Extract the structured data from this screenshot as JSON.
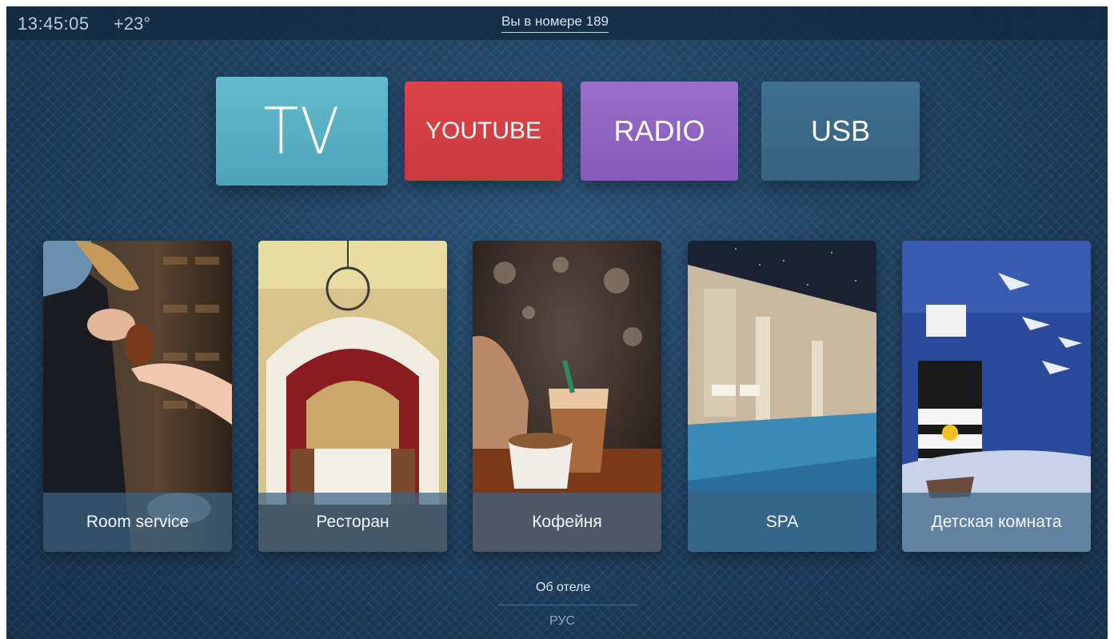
{
  "status_bar": {
    "time": "13:45:05",
    "temperature": "+23°",
    "room_label": "Вы в номере 189"
  },
  "apps": [
    {
      "label": "TV",
      "color": "#55afc4"
    },
    {
      "label": "YOUTUBE",
      "color": "#d64043"
    },
    {
      "label": "RADIO",
      "color": "#9065c2"
    },
    {
      "label": "USB",
      "color": "#3a6987"
    }
  ],
  "services": [
    {
      "label": "Room service"
    },
    {
      "label": "Ресторан"
    },
    {
      "label": "Кофейня"
    },
    {
      "label": "SPA"
    },
    {
      "label": "Детская комната"
    }
  ],
  "footer": {
    "about_label": "Об отеле",
    "language_label": "РУС"
  },
  "colors": {
    "background": "#1d3e5c",
    "caption_bar": "#3a6484"
  }
}
